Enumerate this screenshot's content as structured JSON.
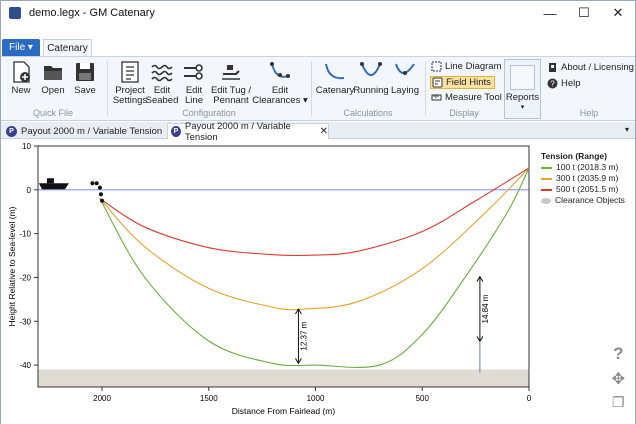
{
  "window": {
    "title": "demo.legx - GM Catenary"
  },
  "ribbon": {
    "file_tab": "File ▾",
    "active_tab": "Catenary",
    "quick_file": {
      "label": "Quick File",
      "buttons": [
        "New",
        "Open",
        "Save"
      ]
    },
    "configuration": {
      "label": "Configuration",
      "buttons": [
        "Project\nSettings",
        "Edit\nSeabed",
        "Edit\nLine",
        "Edit Tug /\nPennant",
        "Edit\nClearances ▾"
      ]
    },
    "calculations": {
      "label": "Calculations",
      "buttons": [
        "Catenary",
        "Running",
        "Laying"
      ]
    },
    "display": {
      "label": "Display",
      "line_diagram": "Line Diagram",
      "field_hints": "Field Hints",
      "measure_tool": "Measure Tool"
    },
    "reports": {
      "label": "Reports"
    },
    "help": {
      "label": "Help",
      "about": "About / Licensing",
      "help": "Help"
    }
  },
  "doc_tabs": [
    {
      "icon": "P",
      "label": "Payout 2000 m / Variable Tension",
      "active": false
    },
    {
      "icon": "P",
      "label": "Payout 2000 m / Variable Tension",
      "active": true
    }
  ],
  "chart_data": {
    "type": "line",
    "xlabel": "Distance From Fairlead (m)",
    "ylabel": "Height Relative to Sea-level (m)",
    "xlim": [
      2300,
      0
    ],
    "ylim": [
      -45,
      10
    ],
    "xticks": [
      2000,
      1500,
      1000,
      500,
      0
    ],
    "yticks": [
      10,
      0,
      -10,
      -20,
      -30,
      -40
    ],
    "seabed_depth": -41,
    "legend_title": "Tension (Range)",
    "series": [
      {
        "name": "100 t (2018.3 m)",
        "color": "#6aae3c",
        "points": [
          [
            2010,
            -2
          ],
          [
            1800,
            -20
          ],
          [
            1500,
            -34.5
          ],
          [
            1200,
            -39.6
          ],
          [
            1000,
            -40
          ],
          [
            700,
            -40
          ],
          [
            500,
            -33
          ],
          [
            300,
            -20
          ],
          [
            100,
            -5
          ],
          [
            0,
            5
          ]
        ]
      },
      {
        "name": "300 t (2035.9 m)",
        "color": "#e7a22c",
        "points": [
          [
            2010,
            -2
          ],
          [
            1800,
            -13
          ],
          [
            1500,
            -22.5
          ],
          [
            1200,
            -26.8
          ],
          [
            1050,
            -27.2
          ],
          [
            800,
            -25.5
          ],
          [
            500,
            -18
          ],
          [
            200,
            -5
          ],
          [
            0,
            5
          ]
        ]
      },
      {
        "name": "500 t (2051.5 m)",
        "color": "#d93a2f",
        "points": [
          [
            2010,
            -2
          ],
          [
            1800,
            -8.5
          ],
          [
            1500,
            -13.2
          ],
          [
            1200,
            -14.8
          ],
          [
            1000,
            -14.9
          ],
          [
            800,
            -14
          ],
          [
            500,
            -9.5
          ],
          [
            250,
            -2.5
          ],
          [
            0,
            5
          ]
        ]
      }
    ],
    "clearance_label": "Clearance Objects",
    "annotations": [
      {
        "text": "12.37 m",
        "x": 1080,
        "y_top": -27.2,
        "y_bottom": -39.6
      },
      {
        "text": "14.84 m",
        "x": 230,
        "y_top": -19.8,
        "y_bottom": -34.6
      }
    ]
  }
}
